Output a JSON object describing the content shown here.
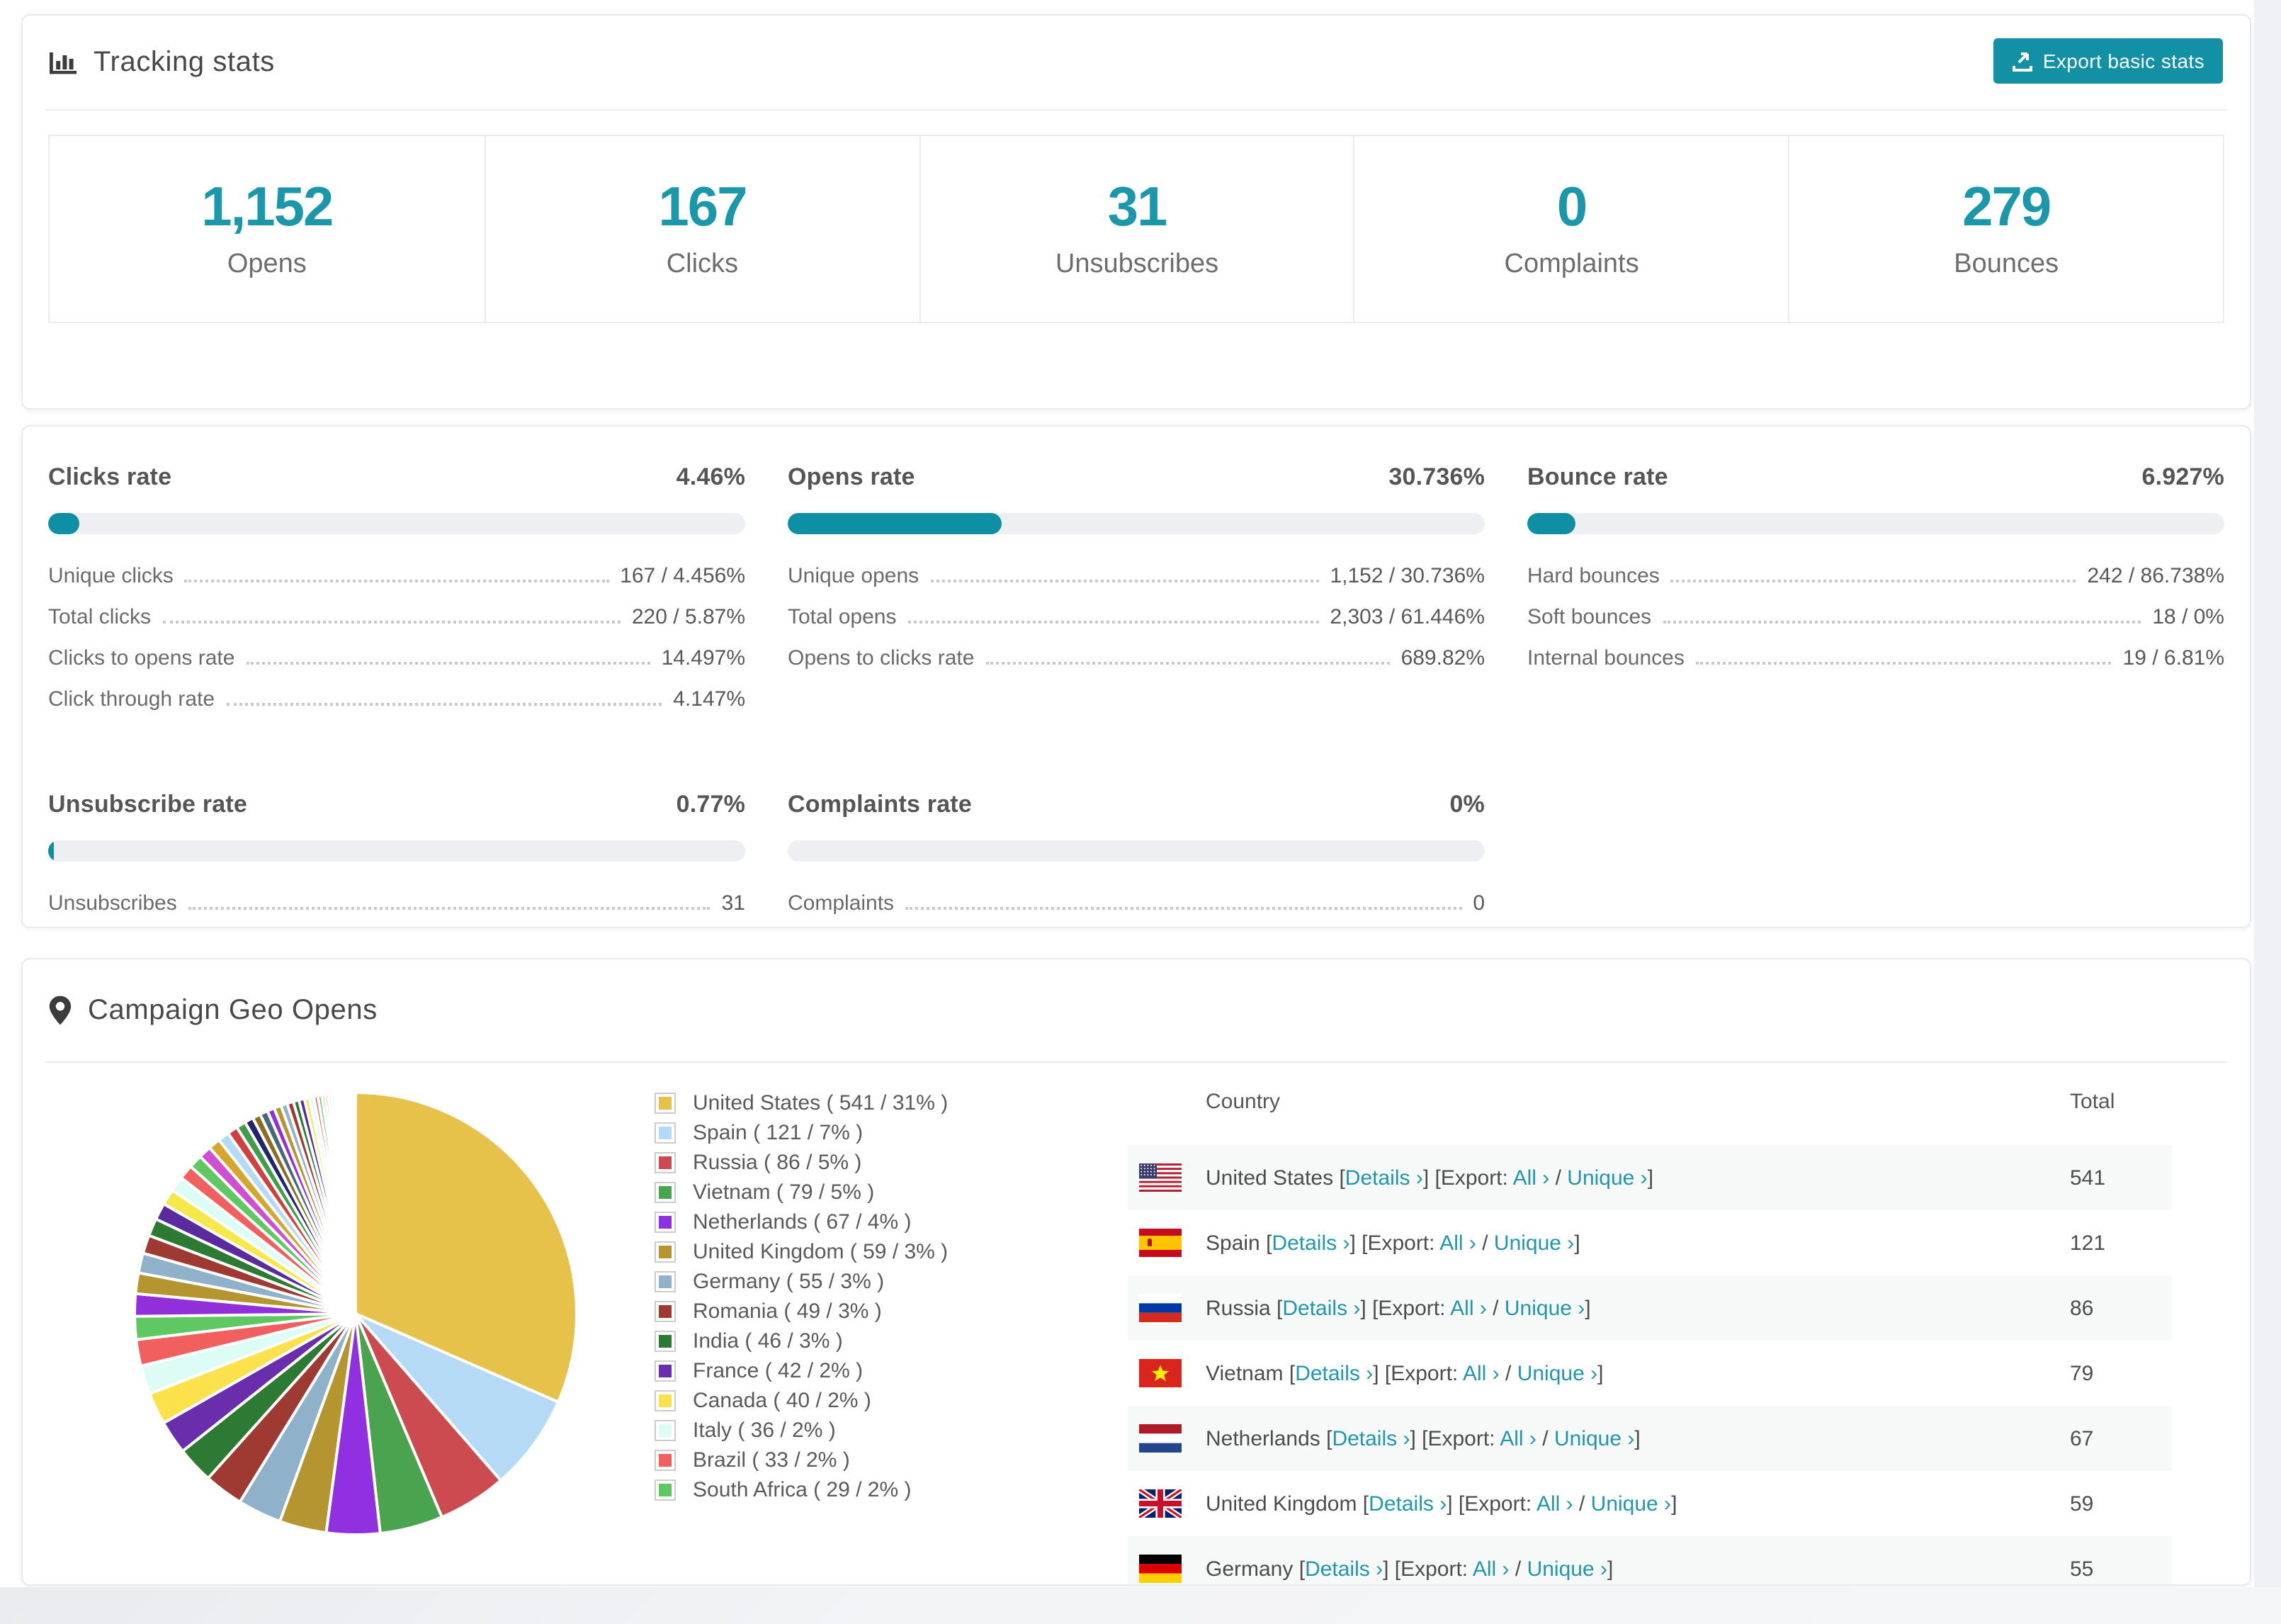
{
  "colors": {
    "accent_button": "#1390a3",
    "accent_number": "#1b97ab",
    "accent_link": "#2097ac",
    "bar_track": "#edeff2",
    "bar_fill": "#0e8fa4",
    "row_stripe": "#f7f8f8"
  },
  "tracking": {
    "title": "Tracking stats",
    "export_button": "Export basic stats",
    "stats": [
      {
        "value": "1,152",
        "label": "Opens"
      },
      {
        "value": "167",
        "label": "Clicks"
      },
      {
        "value": "31",
        "label": "Unsubscribes"
      },
      {
        "value": "0",
        "label": "Complaints"
      },
      {
        "value": "279",
        "label": "Bounces"
      }
    ]
  },
  "rates": {
    "panels": [
      {
        "title": "Clicks rate",
        "value": "4.46%",
        "progress": 4.46,
        "rows": [
          [
            "Unique clicks",
            "167 / 4.456%"
          ],
          [
            "Total clicks",
            "220 / 5.87%"
          ],
          [
            "Clicks to opens rate",
            "14.497%"
          ],
          [
            "Click through rate",
            "4.147%"
          ]
        ]
      },
      {
        "title": "Opens rate",
        "value": "30.736%",
        "progress": 30.736,
        "rows": [
          [
            "Unique opens",
            "1,152 / 30.736%"
          ],
          [
            "Total opens",
            "2,303 / 61.446%"
          ],
          [
            "Opens to clicks rate",
            "689.82%"
          ]
        ]
      },
      {
        "title": "Bounce rate",
        "value": "6.927%",
        "progress": 6.927,
        "rows": [
          [
            "Hard bounces",
            "242 / 86.738%"
          ],
          [
            "Soft bounces",
            "18 / 0%"
          ],
          [
            "Internal bounces",
            "19 / 6.81%"
          ]
        ]
      },
      {
        "title": "Unsubscribe rate",
        "value": "0.77%",
        "progress": 0.77,
        "rows": [
          [
            "Unsubscribes",
            "31"
          ]
        ]
      },
      {
        "title": "Complaints rate",
        "value": "0%",
        "progress": 0,
        "rows": [
          [
            "Complaints",
            "0"
          ]
        ]
      }
    ]
  },
  "geo": {
    "title": "Campaign Geo Opens",
    "table": {
      "columns": [
        "Country",
        "Total"
      ],
      "bracket_open": "[",
      "bracket_close": "]",
      "details_label": "Details ›",
      "export_prefix": "Export:",
      "all_label": "All ›",
      "slash": "/",
      "unique_label": "Unique ›",
      "rows": [
        {
          "country": "United States",
          "flag": "us",
          "total": "541"
        },
        {
          "country": "Spain",
          "flag": "es",
          "total": "121"
        },
        {
          "country": "Russia",
          "flag": "ru",
          "total": "86"
        },
        {
          "country": "Vietnam",
          "flag": "vn",
          "total": "79"
        },
        {
          "country": "Netherlands",
          "flag": "nl",
          "total": "67"
        },
        {
          "country": "United Kingdom",
          "flag": "gb",
          "total": "59"
        },
        {
          "country": "Germany",
          "flag": "de",
          "total": "55"
        }
      ]
    }
  },
  "chart_data": {
    "type": "pie",
    "title": "Campaign Geo Opens",
    "legend_position": "right",
    "start_angle_deg": -90,
    "direction": "clockwise",
    "slices": [
      {
        "label": "United States",
        "value": 541,
        "pct": "31%",
        "color": "#e6c24a"
      },
      {
        "label": "Spain",
        "value": 121,
        "pct": "7%",
        "color": "#b5daf5"
      },
      {
        "label": "Russia",
        "value": 86,
        "pct": "5%",
        "color": "#cc4b51"
      },
      {
        "label": "Vietnam",
        "value": 79,
        "pct": "5%",
        "color": "#4aa34f"
      },
      {
        "label": "Netherlands",
        "value": 67,
        "pct": "4%",
        "color": "#9130e0"
      },
      {
        "label": "United Kingdom",
        "value": 59,
        "pct": "3%",
        "color": "#b5952f"
      },
      {
        "label": "Germany",
        "value": 55,
        "pct": "3%",
        "color": "#8fb2ca"
      },
      {
        "label": "Romania",
        "value": 49,
        "pct": "3%",
        "color": "#9e3a31"
      },
      {
        "label": "India",
        "value": 46,
        "pct": "3%",
        "color": "#2c7a33"
      },
      {
        "label": "France",
        "value": 42,
        "pct": "2%",
        "color": "#6a2dab"
      },
      {
        "label": "Canada",
        "value": 40,
        "pct": "2%",
        "color": "#fbe14b"
      },
      {
        "label": "Italy",
        "value": 36,
        "pct": "2%",
        "color": "#defcf6"
      },
      {
        "label": "Brazil",
        "value": 33,
        "pct": "2%",
        "color": "#f15f5f"
      },
      {
        "label": "South Africa",
        "value": 29,
        "pct": "2%",
        "color": "#5fc863"
      }
    ],
    "unlabeled_tail": {
      "note": "remaining smaller countries shown as progressively thinner unlabeled slices",
      "values": [
        28,
        26,
        25,
        23,
        22,
        21,
        20,
        19,
        18,
        17,
        16,
        15,
        14,
        13,
        12,
        11,
        10,
        10,
        9,
        9,
        8,
        8,
        7,
        7,
        6,
        6,
        5,
        5,
        4,
        4,
        4,
        3,
        3,
        3,
        2,
        2,
        2,
        2,
        2,
        1,
        1,
        1,
        1,
        1,
        1,
        1,
        1,
        1,
        1,
        1
      ],
      "palette": [
        "#9130db",
        "#b5952f",
        "#8fb2ca",
        "#9e3a31",
        "#2c7a33",
        "#5b2b9e",
        "#f7e84a",
        "#defcf6",
        "#f15f5f",
        "#5fc863",
        "#cf4fd1",
        "#d4a72c",
        "#b5daf5",
        "#d23f3f",
        "#3f9e47",
        "#23246e",
        "#8a6d1f",
        "#46697c"
      ]
    }
  }
}
